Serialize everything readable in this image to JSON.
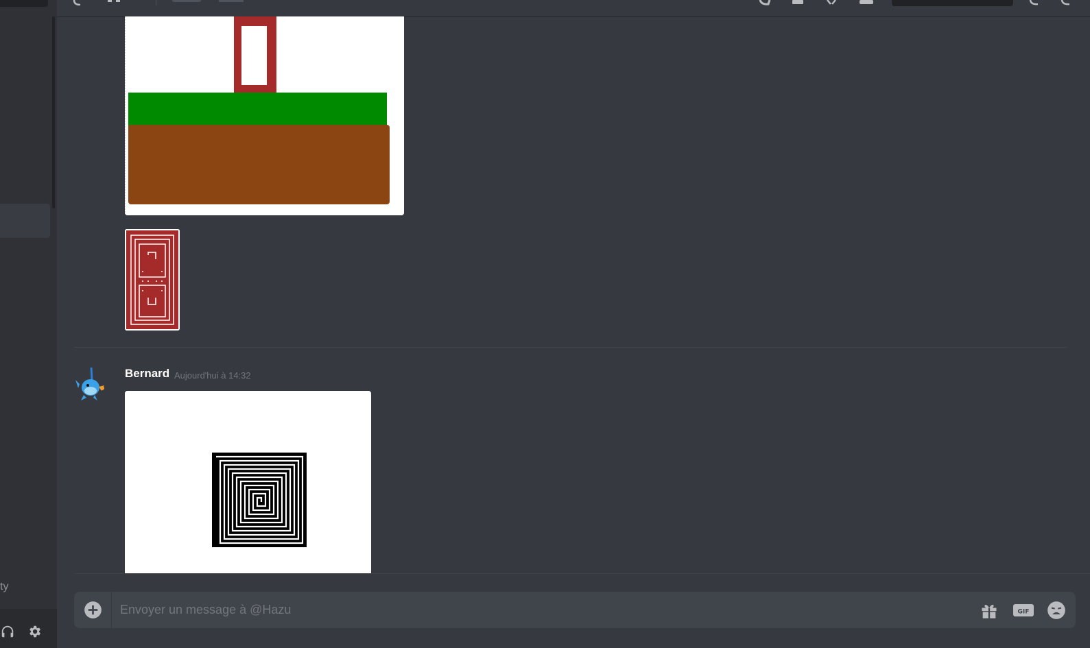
{
  "sidebar": {
    "partial_label": "ty",
    "user_controls": [
      "headphones-icon",
      "gear-icon"
    ]
  },
  "messages": [
    {
      "author": "Bernard",
      "timestamp": "Aujourd'hui à 14:32"
    }
  ],
  "composer": {
    "placeholder": "Envoyer un message à @Hazu",
    "icons": [
      "add-circle-icon",
      "gift-icon",
      "gif-icon",
      "emoji-icon"
    ]
  },
  "colors": {
    "background": "#36393f",
    "sidebar": "#2f3136",
    "composer": "#40444b",
    "icon": "#b9bbbe",
    "grass": "#008a00",
    "dirt": "#8b4513",
    "door": "#a52a2a"
  }
}
